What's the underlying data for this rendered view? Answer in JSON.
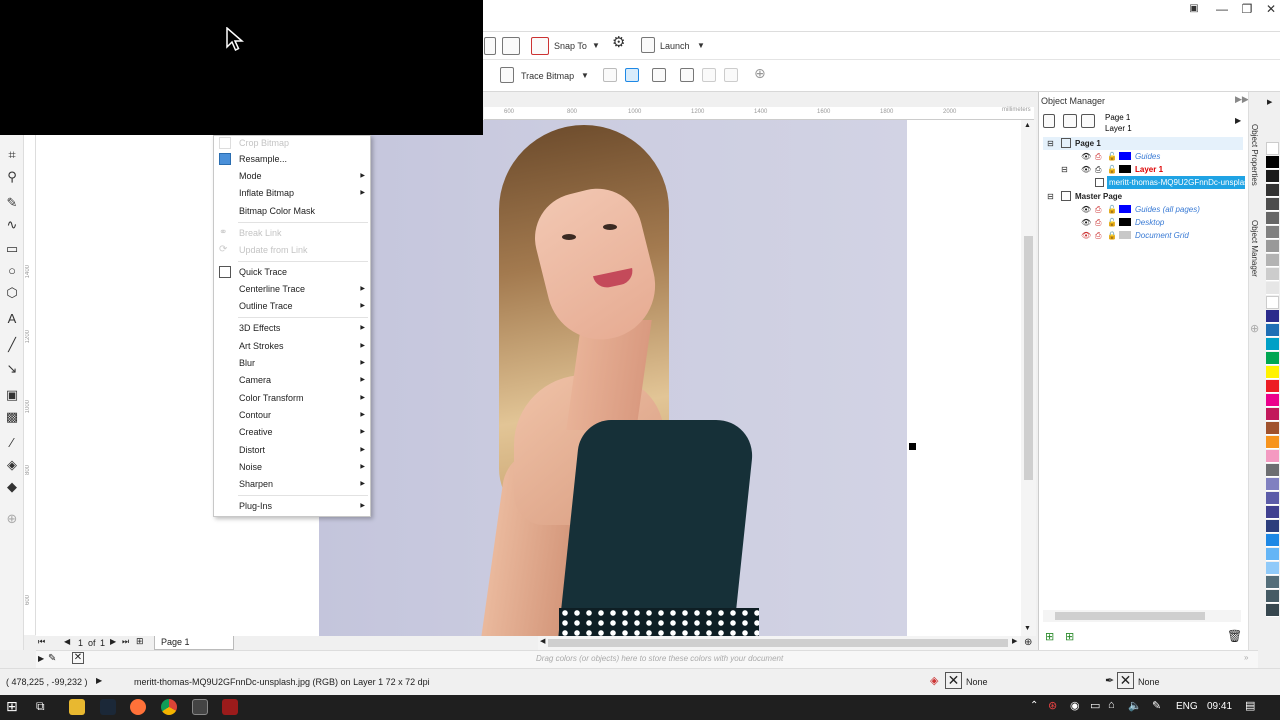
{
  "window": {
    "minimize": "—",
    "maximize": "❐",
    "close": "✕"
  },
  "toolbar1": {
    "snap_to": "Snap To",
    "launch": "Launch"
  },
  "toolbar2": {
    "trace_bitmap": "Trace Bitmap"
  },
  "ruler": {
    "ticks": [
      "600",
      "800",
      "1000",
      "1200",
      "1400",
      "1600",
      "1800",
      "2000"
    ],
    "unit": "millimeters",
    "vticks": [
      "1400",
      "1200",
      "1000",
      "800",
      "600"
    ]
  },
  "context_menu": {
    "items": [
      {
        "label": "Crop Bitmap",
        "disabled": true,
        "submenu": false
      },
      {
        "label": "Resample...",
        "disabled": false,
        "submenu": false
      },
      {
        "label": "Mode",
        "disabled": false,
        "submenu": true
      },
      {
        "label": "Inflate Bitmap",
        "disabled": false,
        "submenu": true
      },
      {
        "label": "Bitmap Color Mask",
        "disabled": false,
        "submenu": false
      },
      {
        "label": "Break Link",
        "disabled": true,
        "submenu": false
      },
      {
        "label": "Update from Link",
        "disabled": true,
        "submenu": false
      },
      {
        "label": "Quick Trace",
        "disabled": false,
        "submenu": false
      },
      {
        "label": "Centerline Trace",
        "disabled": false,
        "submenu": true
      },
      {
        "label": "Outline Trace",
        "disabled": false,
        "submenu": true
      },
      {
        "label": "3D Effects",
        "disabled": false,
        "submenu": true
      },
      {
        "label": "Art Strokes",
        "disabled": false,
        "submenu": true
      },
      {
        "label": "Blur",
        "disabled": false,
        "submenu": true
      },
      {
        "label": "Camera",
        "disabled": false,
        "submenu": true
      },
      {
        "label": "Color Transform",
        "disabled": false,
        "submenu": true
      },
      {
        "label": "Contour",
        "disabled": false,
        "submenu": true
      },
      {
        "label": "Creative",
        "disabled": false,
        "submenu": true
      },
      {
        "label": "Distort",
        "disabled": false,
        "submenu": true
      },
      {
        "label": "Noise",
        "disabled": false,
        "submenu": true
      },
      {
        "label": "Sharpen",
        "disabled": false,
        "submenu": true
      },
      {
        "label": "Plug-Ins",
        "disabled": false,
        "submenu": true
      }
    ]
  },
  "page_nav": {
    "current": "1",
    "of": "of",
    "total": "1",
    "page_tab": "Page 1"
  },
  "object_manager": {
    "title": "Object Manager",
    "header_page": "Page 1",
    "header_layer": "Layer 1",
    "rows": [
      {
        "label": "Page 1",
        "type": "page"
      },
      {
        "label": "Guides",
        "type": "layer",
        "color": "#0000ff"
      },
      {
        "label": "Layer 1",
        "type": "layer-active",
        "color": "#000000"
      },
      {
        "label": "meritt-thomas-MQ9U2GFnnDc-unsplash",
        "type": "object-selected"
      },
      {
        "label": "Master Page",
        "type": "page"
      },
      {
        "label": "Guides (all pages)",
        "type": "master",
        "color": "#0000ff"
      },
      {
        "label": "Desktop",
        "type": "master",
        "color": "#000000"
      },
      {
        "label": "Document Grid",
        "type": "master",
        "color": "#c8c8c8"
      }
    ]
  },
  "docker_tabs": {
    "properties": "Object Properties",
    "manager": "Object Manager"
  },
  "palette_colors": [
    "#ffffff",
    "#000000",
    "#1a1a1a",
    "#333333",
    "#4d4d4d",
    "#666666",
    "#808080",
    "#999999",
    "#b3b3b3",
    "#cccccc",
    "#e6e6e6",
    "#ffffff",
    "#2b2b8c",
    "#1f6fb5",
    "#00a0c6",
    "#00a651",
    "#fff200",
    "#ed1c24",
    "#ec008c",
    "#c2185b",
    "#a0522d",
    "#f7941d",
    "#f49ac1",
    "#6d6e71",
    "#8080c0",
    "#5c5ca8",
    "#404090",
    "#2c3e7c",
    "#1e88e5",
    "#64b5f6",
    "#90caf9",
    "#546e7a",
    "#455a64",
    "#37474f"
  ],
  "doc_palette_hint": "Drag colors (or objects) here to store these colors with your document",
  "status": {
    "coords": "( 478,225 , -99,232 )",
    "info": "meritt-thomas-MQ9U2GFnnDc-unsplash.jpg (RGB) on Layer 1 72 x 72 dpi",
    "fill_label": "None",
    "outline_label": "None"
  },
  "taskbar": {
    "lang": "ENG",
    "time": "09:41"
  }
}
